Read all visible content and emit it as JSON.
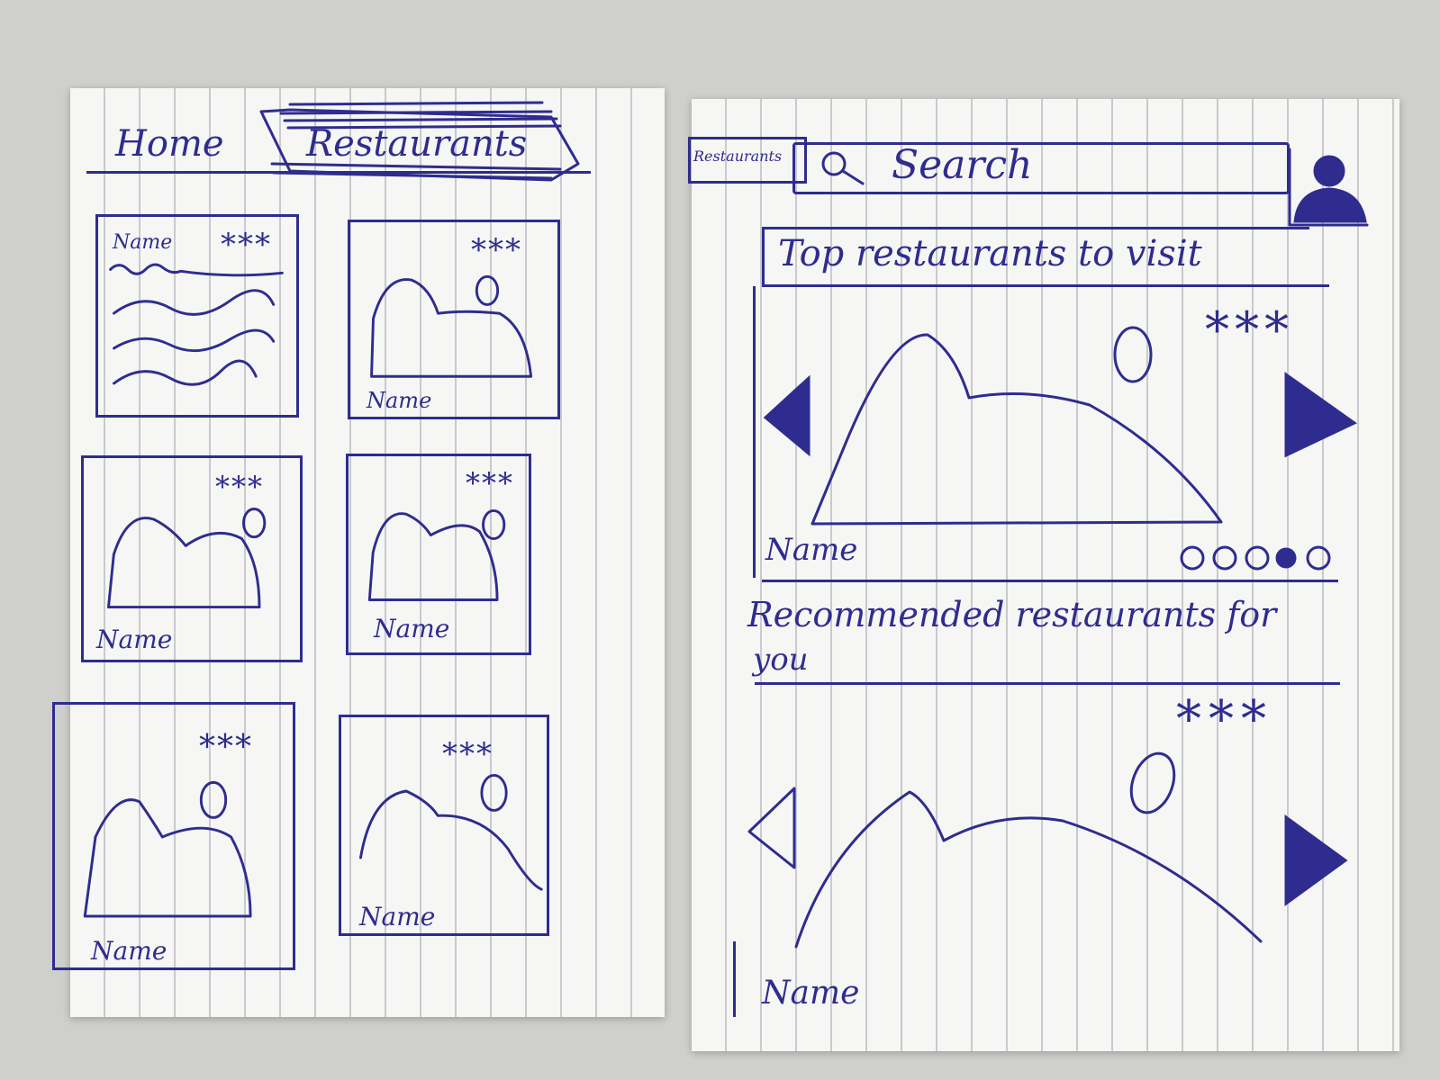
{
  "nav": {
    "home_label": "Home",
    "restaurants_label": "Restaurants"
  },
  "left_cards": [
    {
      "name": "Name",
      "rating": "***",
      "kind": "text"
    },
    {
      "name": "Name",
      "rating": "***",
      "kind": "image"
    },
    {
      "name": "Name",
      "rating": "***",
      "kind": "image"
    },
    {
      "name": "Name",
      "rating": "***",
      "kind": "image"
    },
    {
      "name": "Name",
      "rating": "***",
      "kind": "image"
    },
    {
      "name": "Name",
      "rating": "***",
      "kind": "image"
    }
  ],
  "header": {
    "dropdown_label": "Restaurants",
    "search_placeholder": "Search"
  },
  "top_section": {
    "title": "Top restaurants to visit",
    "card_name": "Name",
    "rating": "***",
    "pagination_dots": 5,
    "active_dot": 4
  },
  "recommended_section": {
    "title_line1": "Recommended restaurants for",
    "title_line2": "you",
    "card_name": "Name",
    "rating": "***"
  },
  "colors": {
    "ink": "#2f2c8f",
    "paper": "#f6f6f4",
    "background": "#cfcfcc"
  }
}
